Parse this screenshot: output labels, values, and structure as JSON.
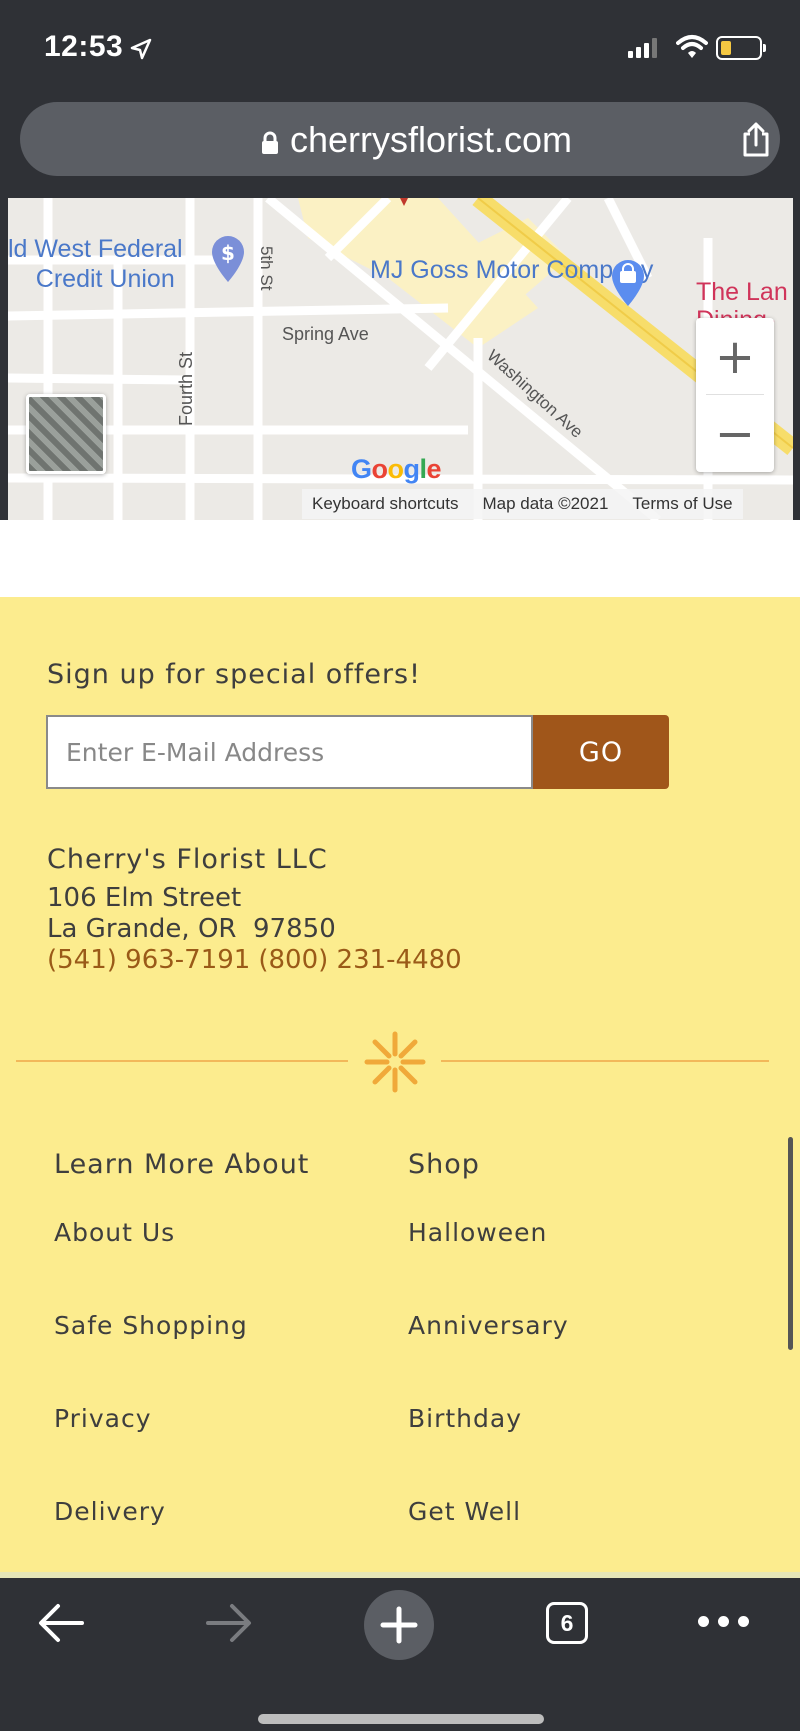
{
  "status_bar": {
    "time": "12:53",
    "icons": [
      "location-arrow-icon",
      "cellular-signal-icon",
      "wifi-icon",
      "battery-icon"
    ]
  },
  "address_bar": {
    "url": "cherrysflorist.com",
    "icons": [
      "lock-icon",
      "share-icon"
    ]
  },
  "map": {
    "labels": {
      "federal": "ld West Federal\nCredit Union",
      "mj_goss": "MJ Goss Motor Company",
      "the_lan": "The Lan\nDining-",
      "spring_ave": "Spring Ave",
      "fifth_st": "5th St",
      "fourth_st": "Fourth St",
      "washington_ave": "Washington Ave"
    },
    "google_logo": "Google",
    "footer": {
      "shortcuts": "Keyboard shortcuts",
      "map_data": "Map data ©2021",
      "terms": "Terms of Use"
    },
    "zoom_in": "+",
    "zoom_out": "−"
  },
  "signup": {
    "title": "Sign up for special offers!",
    "placeholder": "Enter E-Mail Address",
    "button": "GO"
  },
  "contact": {
    "name": "Cherry's Florist LLC",
    "street": "106 Elm Street",
    "city_state_zip": "La Grande, OR  97850",
    "phone_local": "(541) 963-7191",
    "phone_toll_free": "(800) 231-4480"
  },
  "links": {
    "learn_more": {
      "heading": "Learn More About",
      "items": [
        "About Us",
        "Safe Shopping",
        "Privacy",
        "Delivery"
      ]
    },
    "shop": {
      "heading": "Shop",
      "items": [
        "Halloween",
        "Anniversary",
        "Birthday",
        "Get Well"
      ]
    }
  },
  "toolbar": {
    "tab_count": "6"
  },
  "colors": {
    "footer_bg": "#fcec8e",
    "go_button": "#a0561a",
    "phone_text": "#9a5a18",
    "divider": "#f2b85a",
    "browser_chrome": "#2f3136"
  }
}
